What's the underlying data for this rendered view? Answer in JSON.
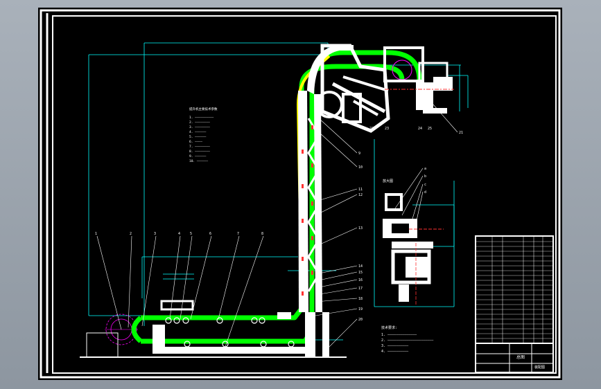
{
  "drawing": {
    "title": "",
    "tech_notes_heading": "技术要求:",
    "tech_notes": [
      "1. ——————————————",
      "2. ——————————————————————",
      "3. ——————————",
      "4. ——————————"
    ],
    "spec_heading": "提升机主要技术参数",
    "spec_lines": [
      "1. ——————————",
      "2. ————————",
      "3. ————————",
      "4. ——————",
      "5. ——————",
      "6. ————",
      "7. ————————",
      "8. ————————",
      "9. ——————",
      "10. ——————"
    ],
    "detail_label": "放大图",
    "colors": {
      "background": "#000000",
      "frame": "#ffffff",
      "chain_outer": "#00ff00",
      "chain_inner": "#ffff00",
      "dimension": "#00ffff",
      "centerline": "#ff3030",
      "hatch": "#ff00ff"
    }
  },
  "title_block": {
    "drawing_name": "总图",
    "company": "装配图"
  }
}
